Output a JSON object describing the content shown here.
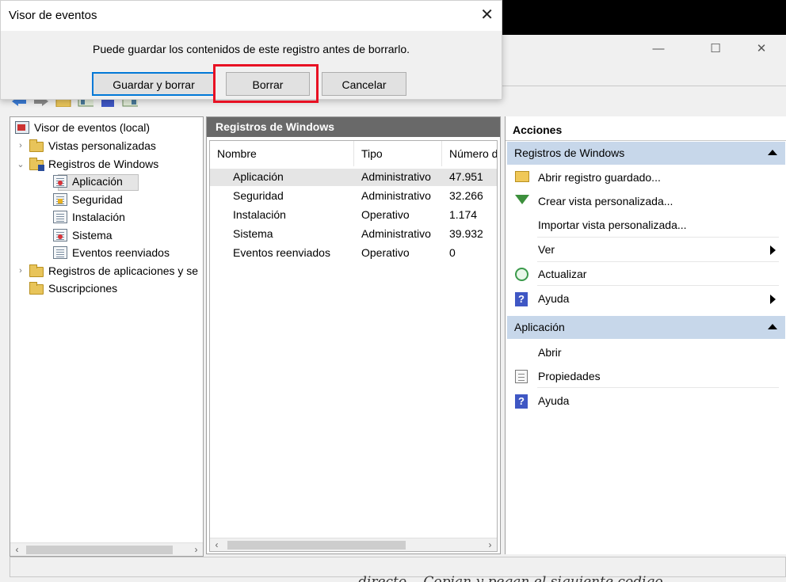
{
  "dialog": {
    "title": "Visor de eventos",
    "close_glyph": "✕",
    "message": "Puede guardar los contenidos de este registro antes de borrarlo.",
    "buttons": {
      "save_and_clear": "Guardar y borrar",
      "clear": "Borrar",
      "cancel": "Cancelar"
    },
    "highlight_color": "#e81123"
  },
  "window": {
    "minimize_glyph": "—",
    "maximize_glyph": "☐",
    "close_glyph": "✕"
  },
  "tree": {
    "root": "Visor de eventos (local)",
    "custom_views": "Vistas personalizadas",
    "windows_logs": "Registros de Windows",
    "logs": [
      "Aplicación",
      "Seguridad",
      "Instalación",
      "Sistema",
      "Eventos reenviados"
    ],
    "apps_services": "Registros de aplicaciones y se",
    "subscriptions": "Suscripciones",
    "expander_collapsed": "›",
    "expander_expanded": "⌄"
  },
  "center": {
    "title": "Registros de Windows",
    "columns": [
      "Nombre",
      "Tipo",
      "Número d"
    ],
    "rows": [
      {
        "name": "Aplicación",
        "type": "Administrativo",
        "count": "47.951"
      },
      {
        "name": "Seguridad",
        "type": "Administrativo",
        "count": "32.266"
      },
      {
        "name": "Instalación",
        "type": "Operativo",
        "count": "1.174"
      },
      {
        "name": "Sistema",
        "type": "Administrativo",
        "count": "39.932"
      },
      {
        "name": "Eventos reenviados",
        "type": "Operativo",
        "count": "0"
      }
    ]
  },
  "actions": {
    "title": "Acciones",
    "group1": {
      "label": "Registros de Windows",
      "items": [
        "Abrir registro guardado...",
        "Crear vista personalizada...",
        "Importar vista personalizada...",
        "Ver",
        "Actualizar",
        "Ayuda"
      ]
    },
    "group2": {
      "label": "Aplicación",
      "items": [
        "Abrir",
        "Propiedades",
        "Ayuda"
      ]
    }
  },
  "scroll": {
    "left": "‹",
    "right": "›"
  },
  "overflow_text": "directo... Copian y pegan el siguiente codigo"
}
